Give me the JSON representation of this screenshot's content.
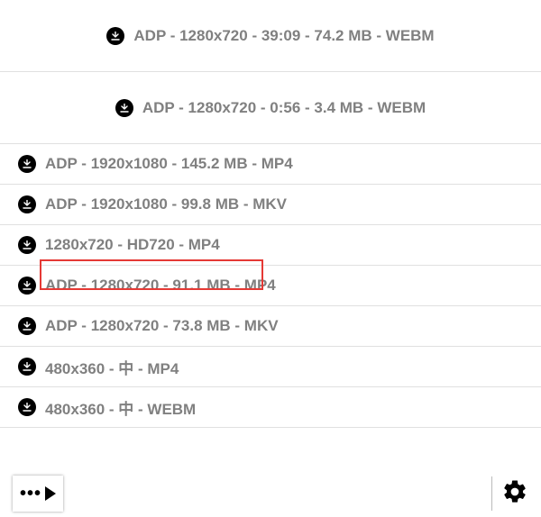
{
  "items": [
    {
      "label": "ADP - 1280x720 - 39:09 - 74.2 MB - WEBM",
      "tall": true
    },
    {
      "label": "ADP - 1280x720 - 0:56 - 3.4 MB - WEBM",
      "tall": true
    },
    {
      "label": "ADP - 1920x1080 - 145.2 MB - MP4",
      "tall": false
    },
    {
      "label": "ADP - 1920x1080 - 99.8 MB - MKV",
      "tall": false
    },
    {
      "label": "1280x720 - HD720 - MP4",
      "tall": false,
      "highlighted": true
    },
    {
      "label": "ADP - 1280x720 - 91.1 MB - MP4",
      "tall": false
    },
    {
      "label": "ADP - 1280x720 - 73.8 MB - MKV",
      "tall": false
    },
    {
      "label": "480x360 - 中 - MP4",
      "tall": false
    },
    {
      "label": "480x360 - 中 - WEBM",
      "tall": false
    }
  ],
  "footer": {
    "menu_label": "•••"
  }
}
